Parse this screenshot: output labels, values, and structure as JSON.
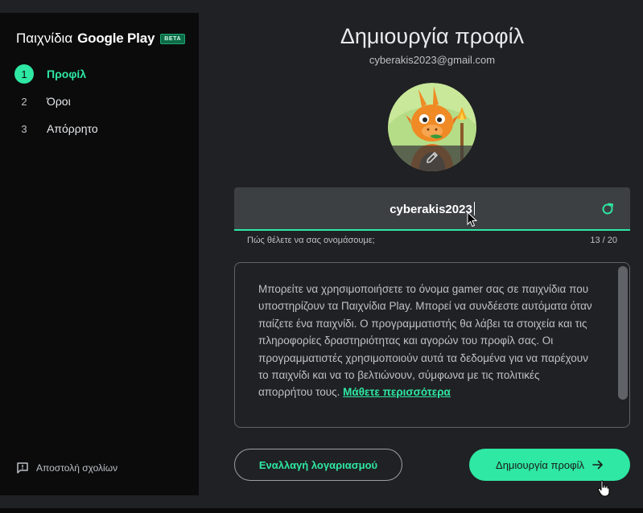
{
  "sidebar": {
    "brand_prefix": "Παιχνίδια",
    "brand_name": "Google Play",
    "badge": "BETA",
    "steps": [
      {
        "num": "1",
        "label": "Προφίλ",
        "active": true
      },
      {
        "num": "2",
        "label": "Όροι",
        "active": false
      },
      {
        "num": "3",
        "label": "Απόρρητο",
        "active": false
      }
    ],
    "feedback_label": "Αποστολή σχολίων"
  },
  "main": {
    "title": "Δημιουργία προφίλ",
    "email": "cyberakis2023@gmail.com",
    "name_field": {
      "value": "cyberakis2023",
      "helper": "Πώς θέλετε να σας ονομάσουμε;",
      "counter": "13 / 20"
    },
    "info_text": "Μπορείτε να χρησιμοποιήσετε το όνομα gamer σας σε παιχνίδια που υποστηρίζουν τα Παιχνίδια Play. Μπορεί να συνδέεστε αυτόματα όταν παίζετε ένα παιχνίδι. Ο προγραμματιστής θα λάβει τα στοιχεία και τις πληροφορίες δραστηριότητας και αγορών του προφίλ σας. Οι προγραμματιστές χρησιμοποιούν αυτά τα δεδομένα για να παρέχουν το παιχνίδι και να το βελτιώνουν, σύμφωνα με τις πολιτικές απορρήτου τους.",
    "learn_more": "Μάθετε περισσότερα",
    "switch_account": "Εναλλαγή λογαριασμού",
    "create_profile": "Δημιουργία προφίλ"
  },
  "colors": {
    "accent": "#2ee8a3",
    "background": "#202124",
    "sidebar": "#0b0b0c",
    "field": "#3c4043"
  },
  "icons": [
    "feedback-icon",
    "refresh-icon",
    "pencil-icon",
    "arrow-right-icon",
    "avatar-dragon"
  ]
}
